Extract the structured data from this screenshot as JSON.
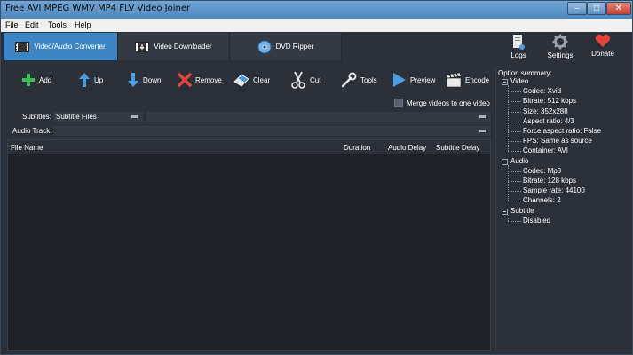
{
  "window": {
    "title": "Free AVI MPEG WMV MP4 FLV Video Joiner",
    "controls": {
      "minimize": "–",
      "maximize": "□",
      "close": "✕"
    }
  },
  "menu": {
    "items": [
      "File",
      "Edit",
      "Tools",
      "Help"
    ]
  },
  "tabs": [
    {
      "label": "Video/Audio Converter",
      "icon": "film-icon",
      "active": true
    },
    {
      "label": "Video Downloader",
      "icon": "film-download-icon",
      "active": false
    },
    {
      "label": "DVD Ripper",
      "icon": "dvd-disc-icon",
      "active": false
    }
  ],
  "toolbar": {
    "add": "Add",
    "up": "Up",
    "down": "Down",
    "remove": "Remove",
    "clear": "Clear",
    "cut": "Cut",
    "tools": "Tools",
    "preview": "Preview",
    "encode": "Encode"
  },
  "right_toolbar": {
    "logs": "Logs",
    "settings": "Settings",
    "donate": "Donate"
  },
  "merge": {
    "label": "Merge videos to one video",
    "checked": false
  },
  "subtitles": {
    "label": "Subtitles:",
    "value": "Subtitle Files"
  },
  "audio_track": {
    "label": "Audio Track:",
    "value": ""
  },
  "list": {
    "columns": [
      "File Name",
      "Duration",
      "Audio Delay",
      "Subtitle Delay"
    ],
    "rows": []
  },
  "summary": {
    "title": "Option summary:",
    "groups": [
      {
        "name": "Video",
        "items": [
          "Codec: Xvid",
          "Bitrate: 512 kbps",
          "Size: 352x288",
          "Aspect ratio: 4/3",
          "Force aspect ratio: False",
          "FPS: Same as source",
          "Container: AVI"
        ]
      },
      {
        "name": "Audio",
        "items": [
          "Codec: Mp3",
          "Bitrate: 128 kbps",
          "Sample rate: 44100",
          "Channels: 2"
        ]
      },
      {
        "name": "Subtitle",
        "items": [
          "Disabled"
        ]
      }
    ]
  },
  "colors": {
    "accent": "#3d86c6",
    "background": "#2b3039",
    "list_background": "#1f2329",
    "add_icon": "#3fbf5a",
    "arrow_icon": "#4a9de0",
    "remove_icon": "#e0453a",
    "donate_heart": "#e0453a"
  }
}
